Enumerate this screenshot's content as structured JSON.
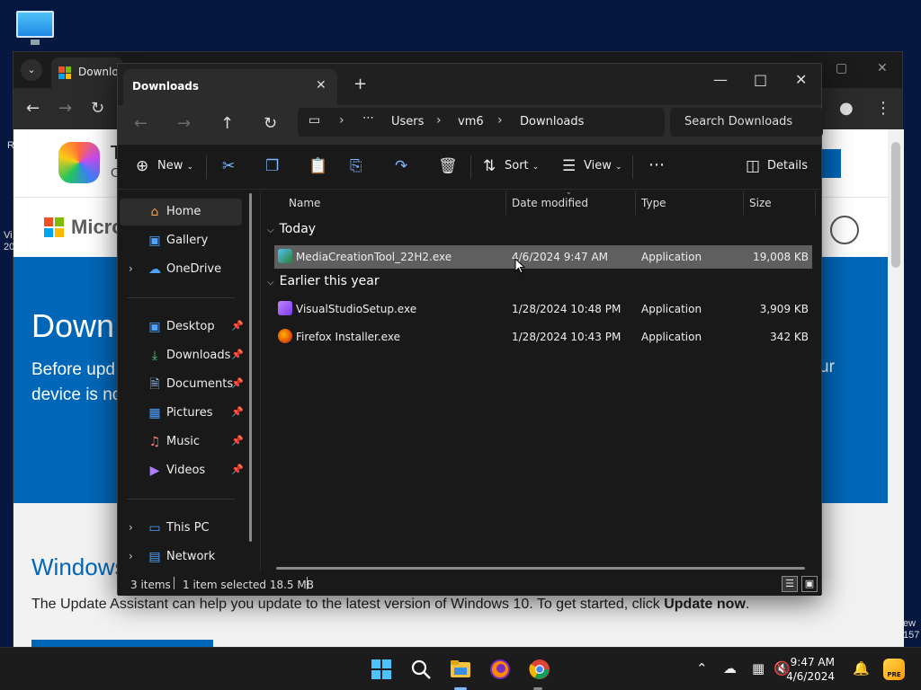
{
  "browser": {
    "tab_title": "Downlo",
    "page": {
      "banner_cut": "T",
      "banner_cut2": "C",
      "brand": "Micros",
      "hero_title": "Down",
      "hero_text_line1": "Before upd",
      "hero_text_line2": "device is no",
      "hero_text_right": "ur",
      "section_title": "Windows",
      "section_text": "The Update Assistant can help you update to the latest version of Windows 10. To get started, click ",
      "section_text_bold": "Update now",
      "section_text_end": "."
    },
    "edge_left_1": "R",
    "edge_left_2a": "Vi",
    "edge_left_2b": "20",
    "edge_right_a": "ew",
    "edge_right_b": "157"
  },
  "explorer": {
    "tab_title": "Downloads",
    "breadcrumb": [
      "Users",
      "vm6",
      "Downloads"
    ],
    "search_placeholder": "Search Downloads",
    "commands": {
      "new": "New",
      "sort": "Sort",
      "view": "View",
      "details": "Details"
    },
    "nav": {
      "home": "Home",
      "gallery": "Gallery",
      "onedrive": "OneDrive",
      "desktop": "Desktop",
      "downloads": "Downloads",
      "documents": "Documents",
      "pictures": "Pictures",
      "music": "Music",
      "videos": "Videos",
      "this_pc": "This PC",
      "network": "Network"
    },
    "columns": {
      "name": "Name",
      "date": "Date modified",
      "type": "Type",
      "size": "Size"
    },
    "groups": {
      "today": "Today",
      "earlier": "Earlier this year"
    },
    "files": [
      {
        "name": "MediaCreationTool_22H2.exe",
        "date": "4/6/2024 9:47 AM",
        "type": "Application",
        "size": "19,008 KB"
      },
      {
        "name": "VisualStudioSetup.exe",
        "date": "1/28/2024 10:48 PM",
        "type": "Application",
        "size": "3,909 KB"
      },
      {
        "name": "Firefox Installer.exe",
        "date": "1/28/2024 10:43 PM",
        "type": "Application",
        "size": "342 KB"
      }
    ],
    "status": {
      "items": "3 items",
      "selected": "1 item selected  18.5 MB"
    }
  },
  "taskbar": {
    "time": "9:47 AM",
    "date": "4/6/2024",
    "pre_label": "PRE"
  },
  "colors": {
    "accent": "#0067b8",
    "selection": "#5f5f5f",
    "explorer_bg": "#191919"
  }
}
